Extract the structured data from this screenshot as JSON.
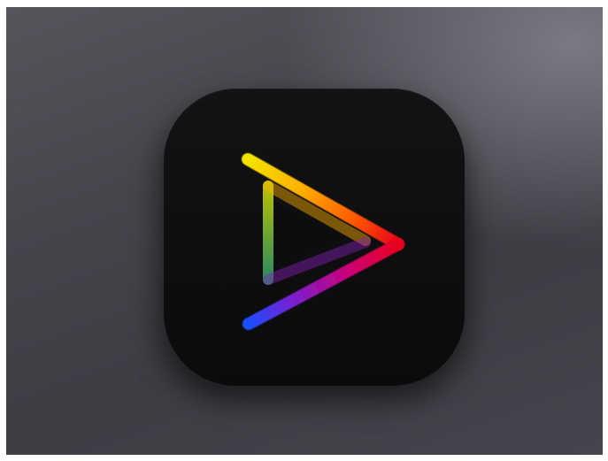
{
  "scene": {
    "background_colors": [
      "#55555c",
      "#3d3d44",
      "#7a7a82"
    ]
  },
  "app_icon": {
    "icon_name": "rainbow-play-icon",
    "tile_color": "#0e0e10",
    "gradient_colors": [
      "#f4e400",
      "#ffb000",
      "#ff5a00",
      "#e8001c",
      "#b8007a",
      "#7a1fd0",
      "#1b4dff",
      "#22d05a"
    ]
  }
}
